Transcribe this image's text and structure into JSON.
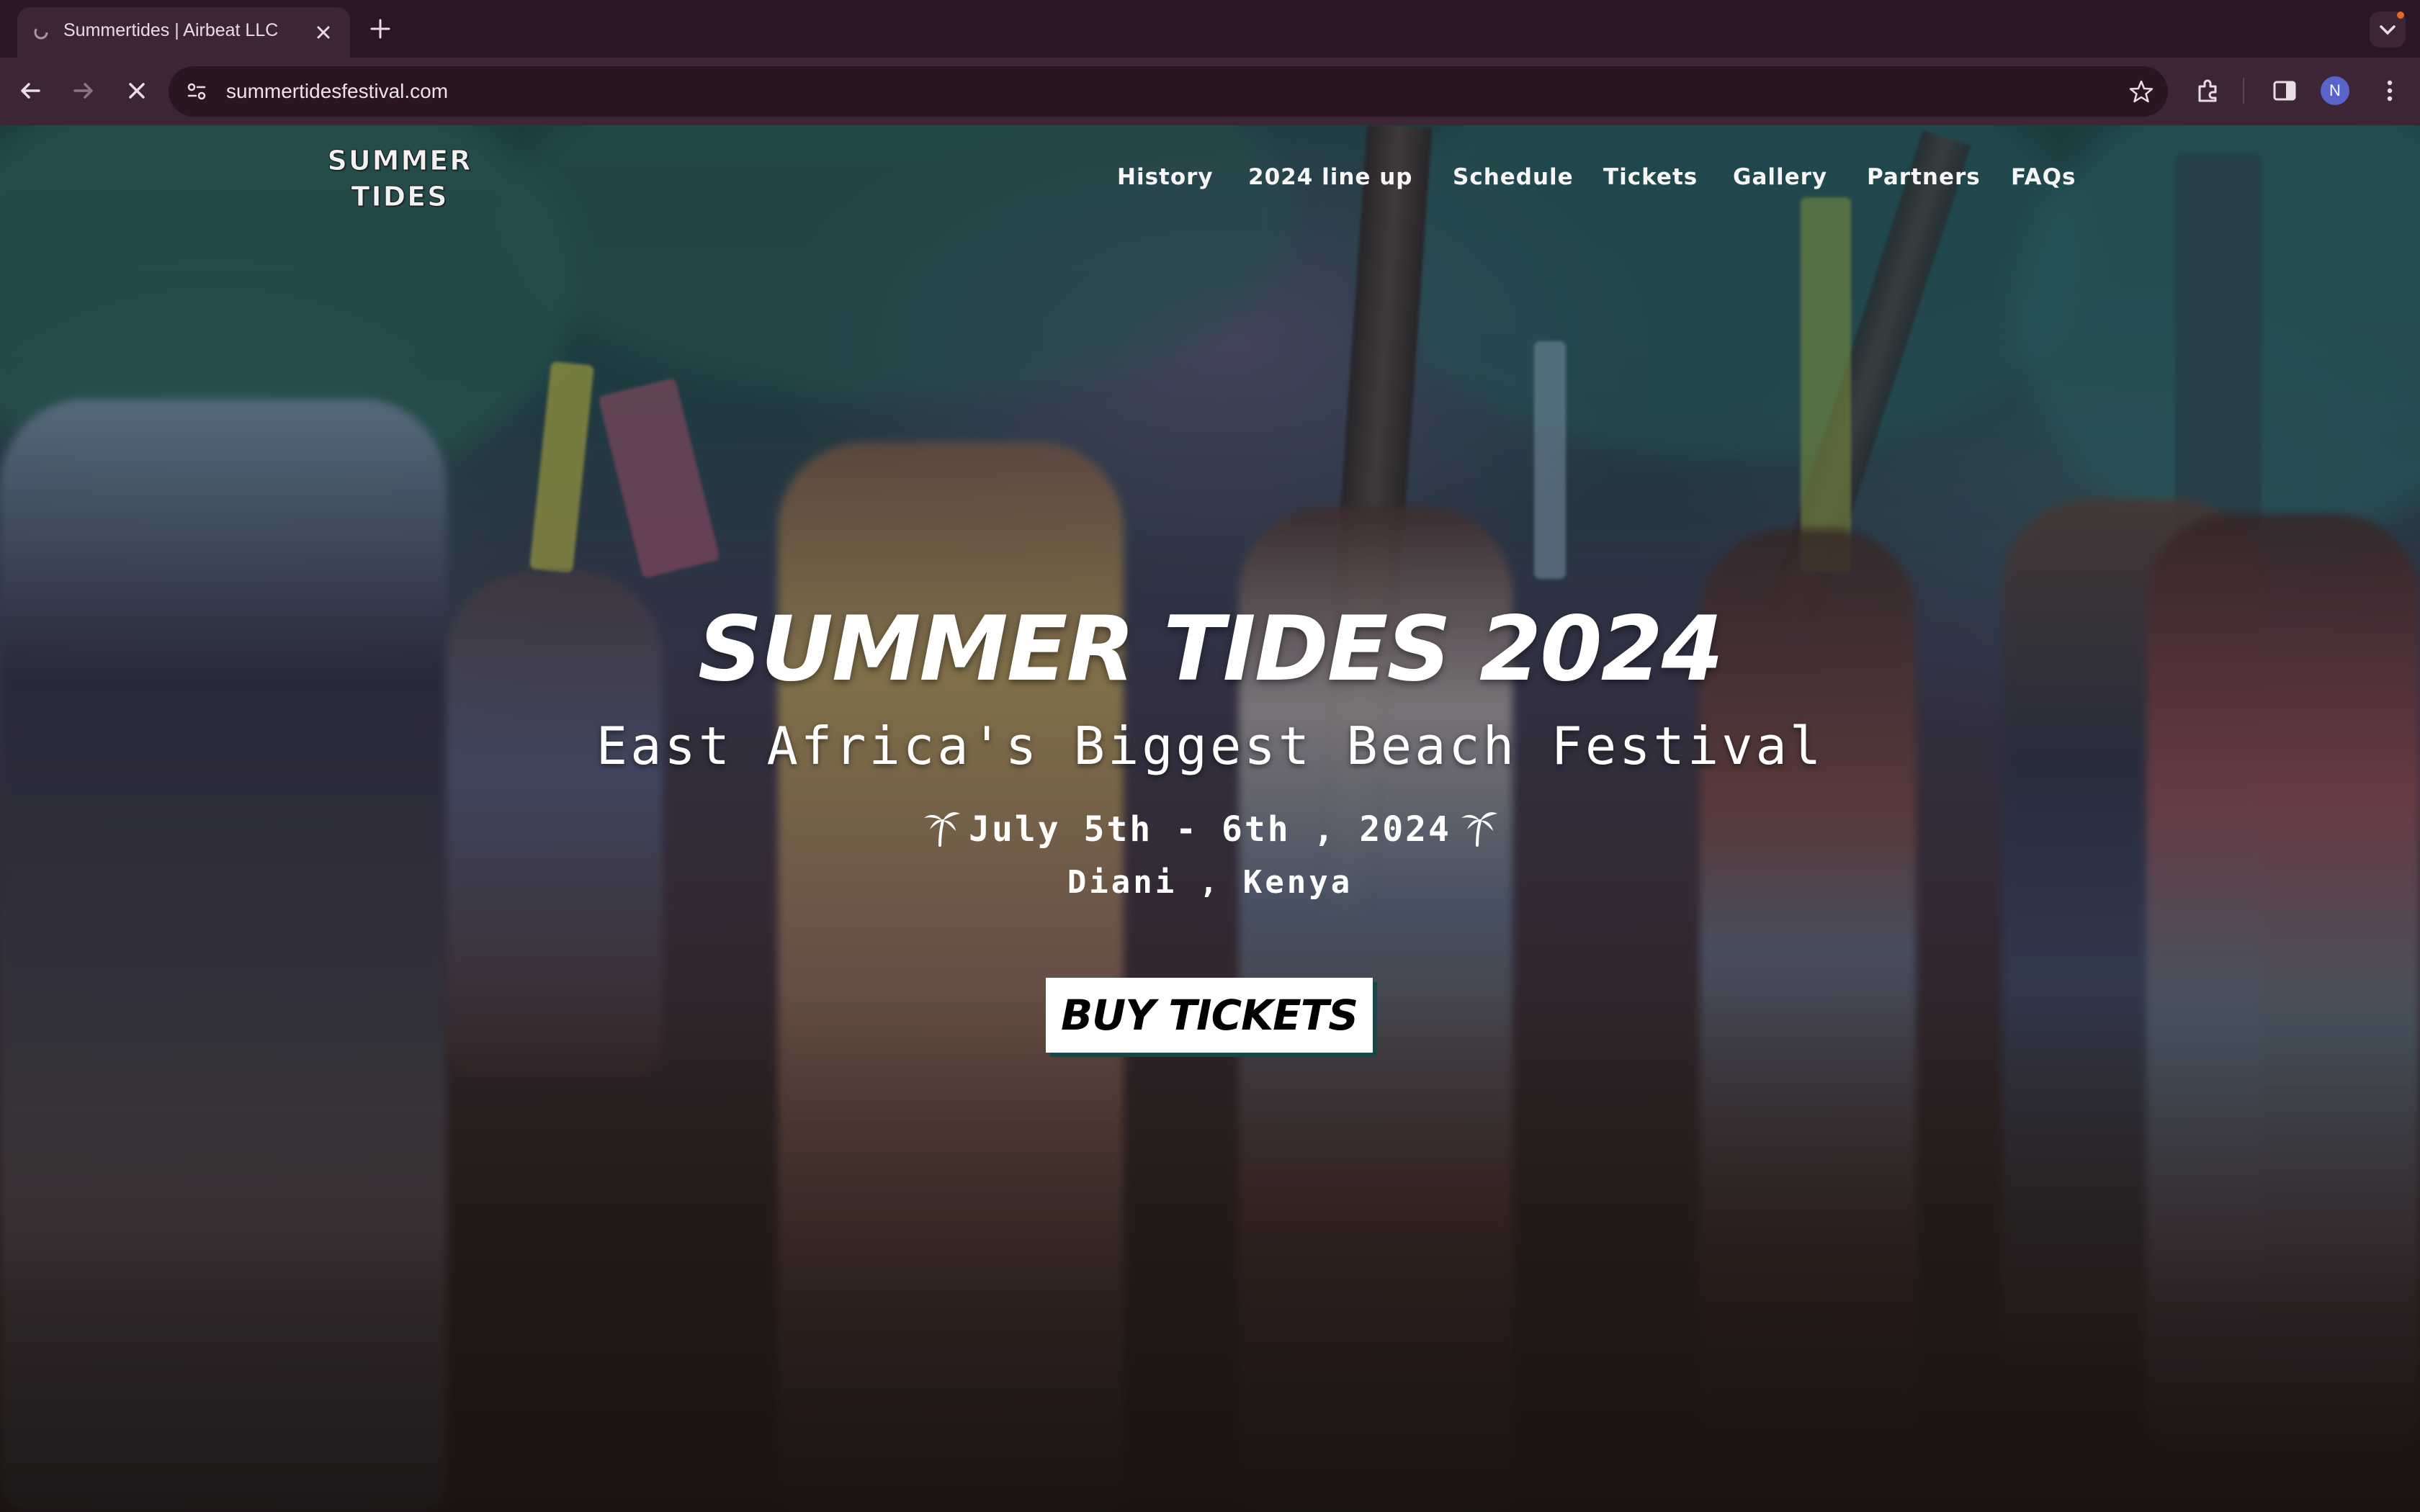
{
  "browser": {
    "tab_title": "Summertides | Airbeat LLC",
    "url": "summertidesfestival.com",
    "profile_initial": "N"
  },
  "site": {
    "logo_line1": "SUMMER",
    "logo_line2": "TIDES",
    "nav": [
      {
        "label": "History"
      },
      {
        "label": "2024 line up"
      },
      {
        "label": "Schedule"
      },
      {
        "label": "Tickets"
      },
      {
        "label": "Gallery"
      },
      {
        "label": "Partners"
      },
      {
        "label": "FAQs"
      }
    ]
  },
  "hero": {
    "title": "SUMMER TIDES 2024",
    "subtitle": "East Africa's Biggest Beach Festival",
    "dates": "July 5th - 6th , 2024",
    "location": "Diani , Kenya",
    "cta": "BUY TICKETS",
    "background": "night beach festival crowd dancing under palm trees"
  },
  "colors": {
    "chrome_bg": "#2b1626",
    "toolbar_bg": "#3c2636",
    "cta_shadow": "#14464a"
  }
}
